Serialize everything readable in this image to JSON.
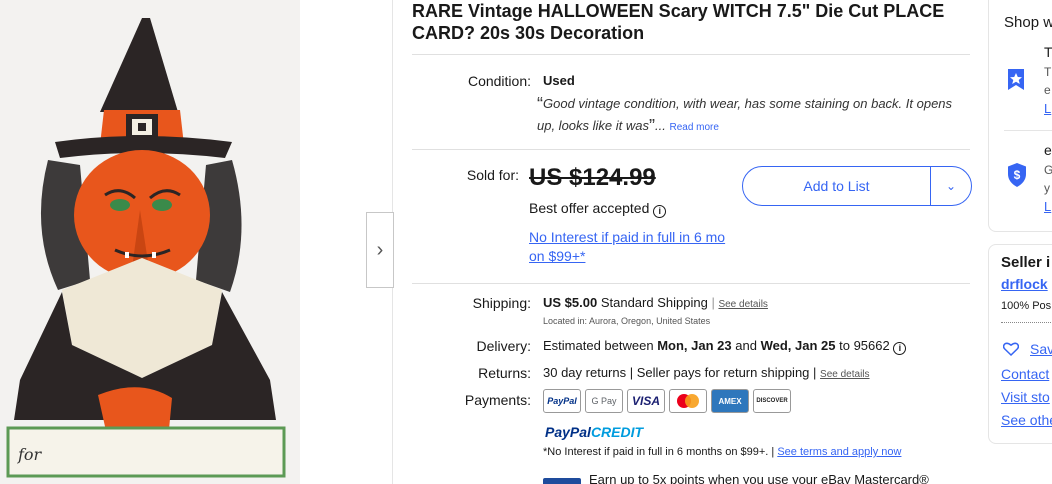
{
  "listing": {
    "title": "RARE Vintage HALLOWEEN Scary WITCH 7.5\" Die Cut PLACE CARD? 20s 30s Decoration",
    "condition_label": "Condition:",
    "condition_value": "Used",
    "condition_note": "Good vintage condition, with wear, has some staining on back. It opens up, looks like it was",
    "ellipsis": "...",
    "read_more": "Read more",
    "sold_for_label": "Sold for:",
    "price": "US $124.99",
    "best_offer": "Best offer accepted",
    "promo": "No Interest if paid in full in 6 mo on $99+*",
    "add_to_list": "Add to List",
    "shipping_label": "Shipping:",
    "shipping_price": "US $5.00",
    "shipping_method": "Standard Shipping",
    "see_details": "See details",
    "located": "Located in: Aurora, Oregon, United States",
    "delivery_label": "Delivery:",
    "delivery_prefix": "Estimated between",
    "delivery_start": "Mon, Jan 23",
    "delivery_and": "and",
    "delivery_end": "Wed, Jan 25",
    "delivery_to": "to 95662",
    "returns_label": "Returns:",
    "returns_text": "30 day returns | Seller pays for return shipping |",
    "payments_label": "Payments:",
    "payment_methods": [
      "PayPal",
      "G Pay",
      "VISA",
      "MC",
      "AMEX",
      "DISCOVER"
    ],
    "paypal_credit_a": "PayPal",
    "paypal_credit_b": "CREDIT",
    "fine_print": "*No Interest if paid in full in 6 months on $99+. |",
    "fine_link": "See terms and apply now",
    "mastercard_promo": "Earn up to 5x points when you use your eBay Mastercard®",
    "card_text": "for"
  },
  "right": {
    "shop_with": "Shop w",
    "t1": "T",
    "t2": "T",
    "t3": "e",
    "l1": "L",
    "e1": "e",
    "g1": "G",
    "y1": "y",
    "l2": "L",
    "seller_info": "Seller i",
    "seller_name": "drflock",
    "positive": "100% Pos",
    "save": "Sav",
    "contact": "Contact",
    "visit": "Visit sto",
    "see_other": "See othe"
  },
  "colors": {
    "link": "#3665f3",
    "paypal_dark": "#003087",
    "paypal_light": "#009cde"
  }
}
